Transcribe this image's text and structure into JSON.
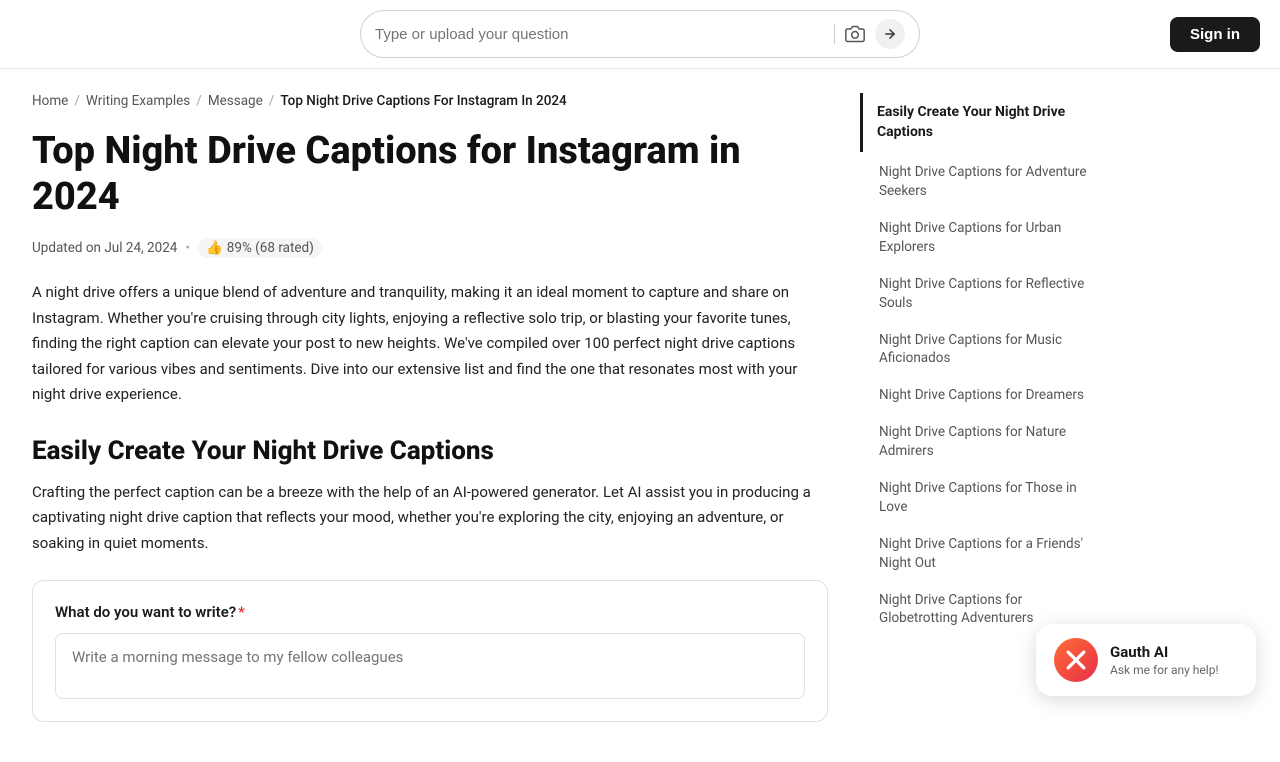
{
  "nav": {
    "search_placeholder": "Type or upload your question",
    "signin_label": "Sign in"
  },
  "breadcrumb": {
    "items": [
      {
        "label": "Home",
        "href": "#"
      },
      {
        "label": "Writing Examples",
        "href": "#"
      },
      {
        "label": "Message",
        "href": "#"
      },
      {
        "label": "Top Night Drive Captions For Instagram In 2024",
        "href": "#",
        "current": true
      }
    ]
  },
  "article": {
    "title": "Top Night Drive Captions for Instagram in 2024",
    "meta": {
      "updated": "Updated on Jul 24, 2024",
      "rating": "89% (68 rated)"
    },
    "body": "A night drive offers a unique blend of adventure and tranquility, making it an ideal moment to capture and share on Instagram. Whether you're cruising through city lights, enjoying a reflective solo trip, or blasting your favorite tunes, finding the right caption can elevate your post to new heights. We've compiled over 100 perfect night drive captions tailored for various vibes and sentiments. Dive into our extensive list and find the one that resonates most with your night drive experience.",
    "section_title": "Easily Create Your Night Drive Captions",
    "section_body": "Crafting the perfect caption can be a breeze with the help of an AI-powered generator. Let AI assist you in producing a captivating night drive caption that reflects your mood, whether you're exploring the city, enjoying an adventure, or soaking in quiet moments.",
    "widget": {
      "label": "What do you want to write?",
      "required": "*",
      "placeholder": "Write a morning message to my fellow colleagues"
    }
  },
  "sidebar": {
    "section_title": "Easily Create Your Night Drive Captions",
    "links": [
      "Night Drive Captions for Adventure Seekers",
      "Night Drive Captions for Urban Explorers",
      "Night Drive Captions for Reflective Souls",
      "Night Drive Captions for Music Aficionados",
      "Night Drive Captions for Dreamers",
      "Night Drive Captions for Nature Admirers",
      "Night Drive Captions for Those in Love",
      "Night Drive Captions for a Friends' Night Out",
      "Night Drive Captions for Globetrotting Adventurers"
    ]
  },
  "gauth": {
    "name": "Gauth AI",
    "tagline": "Ask me for any help!"
  }
}
